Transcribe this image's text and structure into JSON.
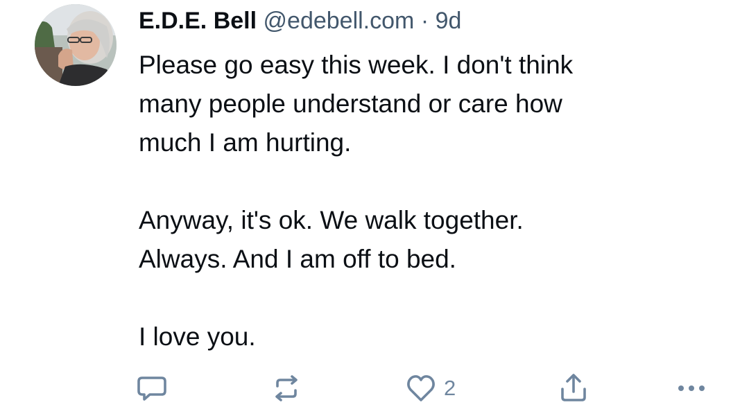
{
  "post": {
    "author_name": "E.D.E. Bell",
    "author_handle": "@edebell.com",
    "separator": "·",
    "age": "9d",
    "lines": [
      "Please go easy this week. I don't think",
      "many people understand or care how",
      "much I am hurting.",
      "",
      "Anyway, it's ok. We walk together.",
      "Always. And I am off to bed.",
      "",
      "I love you."
    ]
  },
  "actions": {
    "reply": {
      "icon": "reply-icon"
    },
    "repost": {
      "icon": "repost-icon"
    },
    "like": {
      "icon": "heart-icon",
      "count": "2"
    },
    "share": {
      "icon": "share-icon"
    },
    "more": {
      "icon": "more-icon"
    }
  },
  "colors": {
    "text": "#0b0f14",
    "muted": "#42576c",
    "icon": "#6f869f",
    "background": "#ffffff"
  }
}
